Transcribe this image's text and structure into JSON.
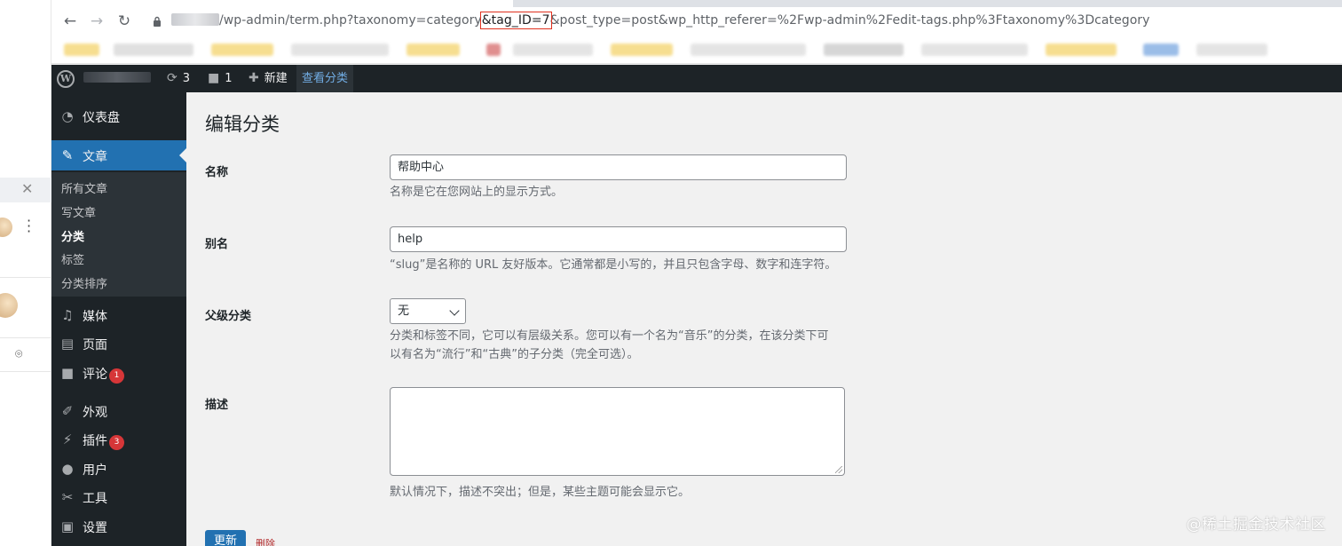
{
  "browser": {
    "url_prefix": "/wp-admin/term.php?taxonomy=category",
    "url_highlight": "&tag_ID=7",
    "url_suffix": "&post_type=post&wp_http_referer=%2Fwp-admin%2Fedit-tags.php%3Ftaxonomy%3Dcategory",
    "back_icon": "←",
    "forward_icon": "→",
    "reload_icon": "↻"
  },
  "adminbar": {
    "updates_count": "3",
    "comments_count": "1",
    "new_label": "新建",
    "view_label": "查看分类"
  },
  "sidebar": {
    "dashboard": "仪表盘",
    "posts": "文章",
    "sub": {
      "all_posts": "所有文章",
      "write_post": "写文章",
      "categories": "分类",
      "tags": "标签",
      "category_order": "分类排序"
    },
    "media": "媒体",
    "pages": "页面",
    "comments": "评论",
    "comments_badge": "1",
    "appearance": "外观",
    "plugins": "插件",
    "plugins_badge": "3",
    "users": "用户",
    "tools": "工具",
    "settings": "设置"
  },
  "form": {
    "title": "编辑分类",
    "name_label": "名称",
    "name_value": "帮助中心",
    "name_desc": "名称是它在您网站上的显示方式。",
    "slug_label": "别名",
    "slug_value": "help",
    "slug_desc": "“slug”是名称的 URL 友好版本。它通常都是小写的，并且只包含字母、数字和连字符。",
    "parent_label": "父级分类",
    "parent_value": "无",
    "parent_desc_1": "分类和标签不同，它可以有层级关系。您可以有一个名为“音乐”的分类，在该分类下可",
    "parent_desc_2": "以有名为“流行”和“古典”的子分类（完全可选）。",
    "description_label": "描述",
    "description_value": "",
    "description_desc": "默认情况下，描述不突出；但是，某些主题可能会显示它。",
    "update_button": "更新",
    "delete_link": "删除"
  },
  "watermark": "@稀土掘金技术社区",
  "colors": {
    "adminbar_bg": "#1d2327",
    "active_menu": "#2271b1",
    "badge": "#d63638",
    "delete": "#b32d2e"
  }
}
